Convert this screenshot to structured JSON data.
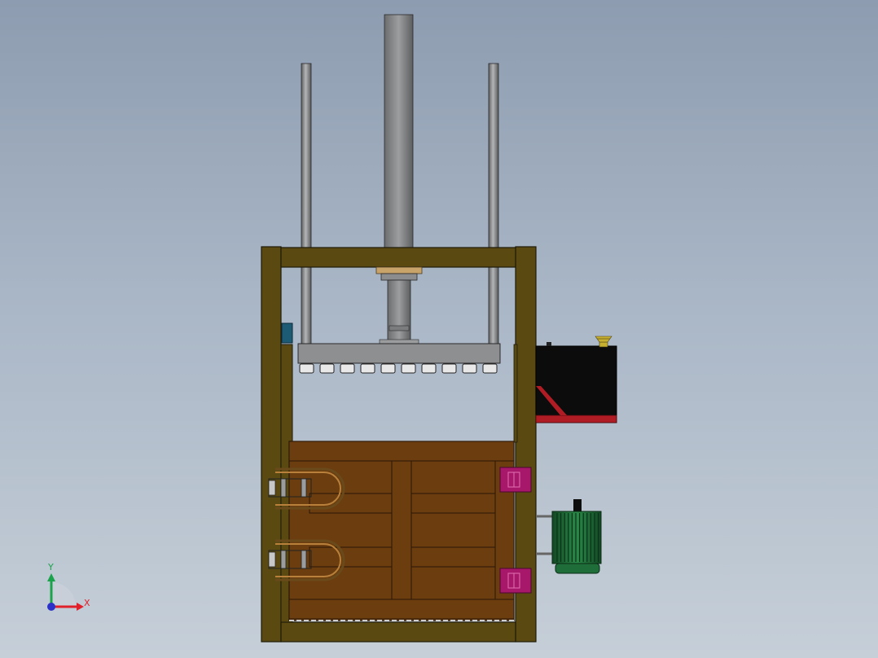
{
  "viewport": {
    "background_top": "#8d9cb0",
    "background_bottom": "#c6cfd8"
  },
  "model": {
    "description_icons": [
      "hydraulic-cylinder",
      "guide-rod",
      "press-platen",
      "baling-chamber-door",
      "door-latch",
      "hinge",
      "hydraulic-tank",
      "electric-motor",
      "oil-filler-cap"
    ],
    "colors": {
      "frame": "#5a4a12",
      "frame_edge": "#1e1a08",
      "door": "#6b3d0f",
      "door_dark": "#4a2a08",
      "steel_gray": "#8a8c8e",
      "tank": "#0c0c0c",
      "tank_accent": "#b01c24",
      "motor": "#1f6e3a",
      "hinge": "#a8186a",
      "cap": "#c8b030",
      "sensor": "#1d5b74"
    }
  },
  "triad": {
    "x_label": "X",
    "y_label": "Y",
    "x_color": "#e0202a",
    "y_color": "#1aa34a",
    "z_color": "#2a30c8"
  }
}
